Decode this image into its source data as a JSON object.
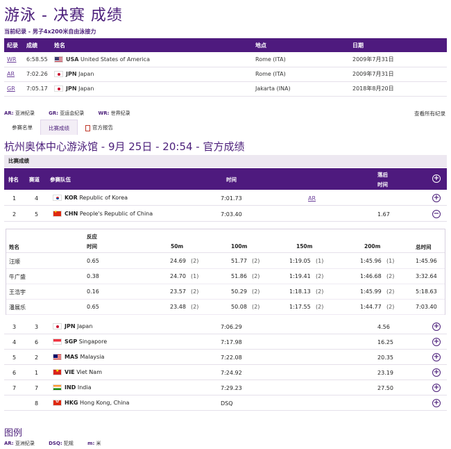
{
  "page": {
    "title": "游泳 - 决赛 成绩",
    "subtitle": "当前纪录 - 男子4x200米自由泳接力"
  },
  "records": {
    "headers": [
      "纪录",
      "成绩",
      "姓名",
      "地点",
      "日期"
    ],
    "rows": [
      {
        "code": "WR",
        "result": "6:58.55",
        "flag": "usa",
        "noc": "USA",
        "name": "United States of America",
        "place": "Rome (ITA)",
        "date": "2009年7月31日"
      },
      {
        "code": "AR",
        "result": "7:02.26",
        "flag": "jpn",
        "noc": "JPN",
        "name": "Japan",
        "place": "Rome (ITA)",
        "date": "2009年7月31日"
      },
      {
        "code": "GR",
        "result": "7:05.17",
        "flag": "jpn",
        "noc": "JPN",
        "name": "Japan",
        "place": "Jakarta (INA)",
        "date": "2018年8月20日"
      }
    ]
  },
  "legend_top": [
    {
      "code": "AR:",
      "label": "亚洲纪录"
    },
    {
      "code": "GR:",
      "label": "亚运会纪录"
    },
    {
      "code": "WR:",
      "label": "世界纪录"
    }
  ],
  "view_all": "查看所有纪录",
  "tabs": [
    "参赛名单",
    "比赛成绩",
    "官方报告"
  ],
  "heading": "杭州奥体中心游泳馆 - 9月 25日 - 20:54 - 官方成绩",
  "section_label": "比赛成绩",
  "results_headers": {
    "rank": "排名",
    "lane": "赛道",
    "team": "参赛队伍",
    "time": "时间",
    "behind_1": "落后",
    "behind_2": "时间"
  },
  "results": [
    {
      "rank": "1",
      "lane": "4",
      "flag": "kor",
      "noc": "KOR",
      "name": "Republic of Korea",
      "time": "7:01.73",
      "record": "AR",
      "behind": "",
      "toggle": "+"
    },
    {
      "rank": "2",
      "lane": "5",
      "flag": "chn",
      "noc": "CHN",
      "name": "People's Republic of China",
      "time": "7:03.40",
      "record": "",
      "behind": "1.67",
      "toggle": "−"
    },
    {
      "rank": "3",
      "lane": "3",
      "flag": "jpn",
      "noc": "JPN",
      "name": "Japan",
      "time": "7:06.29",
      "record": "",
      "behind": "4.56",
      "toggle": "+"
    },
    {
      "rank": "4",
      "lane": "6",
      "flag": "sgp",
      "noc": "SGP",
      "name": "Singapore",
      "time": "7:17.98",
      "record": "",
      "behind": "16.25",
      "toggle": "+"
    },
    {
      "rank": "5",
      "lane": "2",
      "flag": "mas",
      "noc": "MAS",
      "name": "Malaysia",
      "time": "7:22.08",
      "record": "",
      "behind": "20.35",
      "toggle": "+"
    },
    {
      "rank": "6",
      "lane": "1",
      "flag": "vie",
      "noc": "VIE",
      "name": "Viet Nam",
      "time": "7:24.92",
      "record": "",
      "behind": "23.19",
      "toggle": "+"
    },
    {
      "rank": "7",
      "lane": "7",
      "flag": "ind",
      "noc": "IND",
      "name": "India",
      "time": "7:29.23",
      "record": "",
      "behind": "27.50",
      "toggle": "+"
    },
    {
      "rank": "",
      "lane": "8",
      "flag": "hkg",
      "noc": "HKG",
      "name": "Hong Kong, China",
      "time": "DSQ",
      "record": "",
      "behind": "",
      "toggle": "+"
    }
  ],
  "splits": {
    "headers": {
      "name": "姓名",
      "react_1": "反应",
      "react_2": "时间",
      "m50": "50m",
      "m100": "100m",
      "m150": "150m",
      "m200": "200m",
      "total": "总时间"
    },
    "rows": [
      {
        "name": "汪顺",
        "react": "0.65",
        "m50": "24.69",
        "r50": "(2)",
        "m100": "51.77",
        "r100": "(2)",
        "m150": "1:19.05",
        "r150": "(1)",
        "m200": "1:45.96",
        "r200": "(1)",
        "total": "1:45.96"
      },
      {
        "name": "牛广盛",
        "react": "0.38",
        "m50": "24.70",
        "r50": "(1)",
        "m100": "51.86",
        "r100": "(2)",
        "m150": "1:19.41",
        "r150": "(2)",
        "m200": "1:46.68",
        "r200": "(2)",
        "total": "3:32.64"
      },
      {
        "name": "王浩宇",
        "react": "0.16",
        "m50": "23.57",
        "r50": "(2)",
        "m100": "50.29",
        "r100": "(2)",
        "m150": "1:18.13",
        "r150": "(2)",
        "m200": "1:45.99",
        "r200": "(2)",
        "total": "5:18.63"
      },
      {
        "name": "潘展乐",
        "react": "0.65",
        "m50": "23.48",
        "r50": "(2)",
        "m100": "50.08",
        "r100": "(2)",
        "m150": "1:17.55",
        "r150": "(2)",
        "m200": "1:44.77",
        "r200": "(2)",
        "total": "7:03.40"
      }
    ]
  },
  "legend": {
    "title": "图例",
    "items": [
      {
        "code": "AR:",
        "label": "亚洲纪录"
      },
      {
        "code": "DSQ:",
        "label": "犯规"
      },
      {
        "code": "m:",
        "label": "米"
      }
    ]
  },
  "colors": {
    "brand": "#4e1a7e",
    "accent": "#4b1e7a"
  }
}
